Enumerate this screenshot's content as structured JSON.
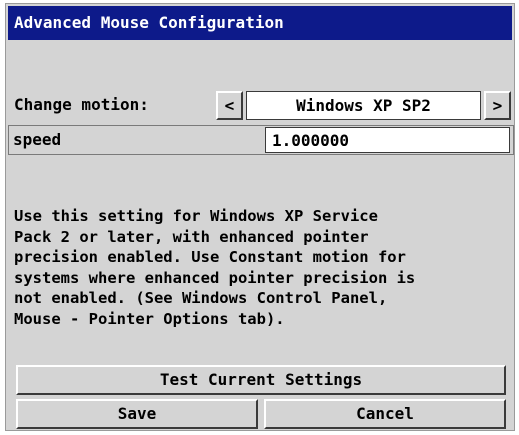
{
  "window": {
    "title": "Advanced Mouse Configuration"
  },
  "motion": {
    "label": "Change motion:",
    "prev_glyph": "<",
    "next_glyph": ">",
    "value": "Windows XP SP2"
  },
  "speed": {
    "label": "speed",
    "value": "1.000000"
  },
  "description": {
    "text": "Use this setting for Windows XP Service\nPack 2 or later, with enhanced pointer\nprecision enabled. Use Constant motion for\nsystems where enhanced pointer precision is\nnot enabled. (See Windows Control Panel,\nMouse - Pointer Options tab)."
  },
  "buttons": {
    "test": "Test Current Settings",
    "save": "Save",
    "cancel": "Cancel"
  },
  "colors": {
    "titlebar": "#0d1a8a",
    "panel": "#d4d4d4"
  }
}
